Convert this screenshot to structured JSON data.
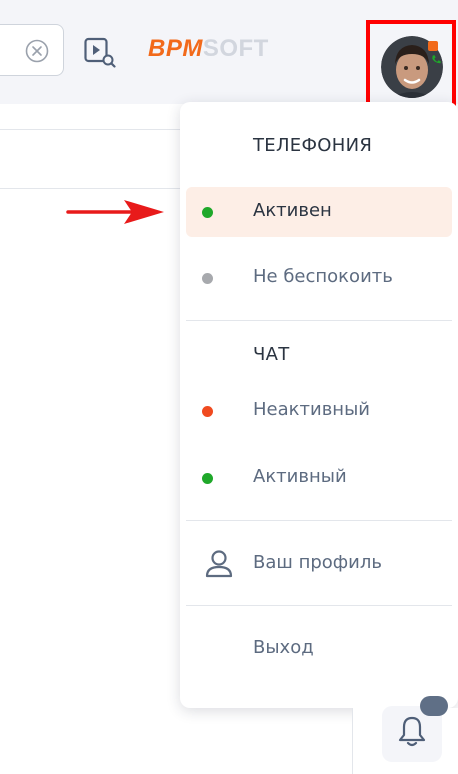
{
  "header": {
    "logo_primary": "BPM",
    "logo_secondary": "SOFT",
    "search_clear_icon": "clear-circle-icon",
    "video_icon": "video-search-icon"
  },
  "user_menu": {
    "telephony_title": "ТЕЛЕФОНИЯ",
    "telephony_items": [
      {
        "label": "Активен",
        "status_color": "#1fa82a",
        "selected": true
      },
      {
        "label": "Не беспокоить",
        "status_color": "#a7a9ad",
        "selected": false
      }
    ],
    "chat_title": "ЧАТ",
    "chat_items": [
      {
        "label": "Неактивный",
        "status_color": "#f04a1f"
      },
      {
        "label": "Активный",
        "status_color": "#1fa82a"
      }
    ],
    "profile_label": "Ваш профиль",
    "logout_label": "Выход"
  },
  "colors": {
    "accent": "#f26a1b",
    "highlight_frame": "#ff0000",
    "selected_bg": "#fdeee6"
  }
}
